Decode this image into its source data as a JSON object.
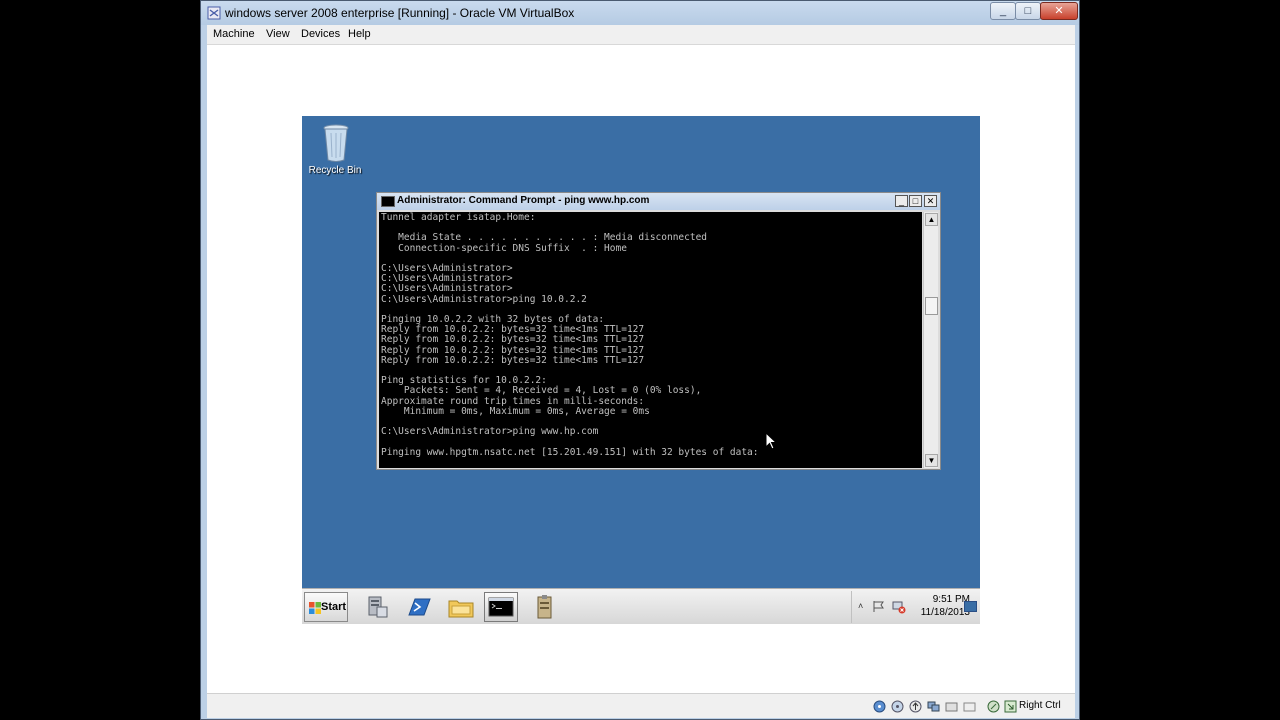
{
  "vbox": {
    "title": "windows server 2008 enterprise [Running] - Oracle VM VirtualBox",
    "controls": {
      "minimize": "_",
      "maximize": "□",
      "close": "✕"
    },
    "menu": [
      "Machine",
      "View",
      "Devices",
      "Help"
    ],
    "host_key_label": "Right Ctrl"
  },
  "desktop": {
    "background_color": "#3a6ea5",
    "recycle_bin_label": "Recycle Bin"
  },
  "cmd": {
    "title": "Administrator: Command Prompt - ping  www.hp.com",
    "lines": [
      "Tunnel adapter isatap.Home:",
      "",
      "   Media State . . . . . . . . . . . : Media disconnected",
      "   Connection-specific DNS Suffix  . : Home",
      "",
      "C:\\Users\\Administrator>",
      "C:\\Users\\Administrator>",
      "C:\\Users\\Administrator>",
      "C:\\Users\\Administrator>ping 10.0.2.2",
      "",
      "Pinging 10.0.2.2 with 32 bytes of data:",
      "Reply from 10.0.2.2: bytes=32 time<1ms TTL=127",
      "Reply from 10.0.2.2: bytes=32 time<1ms TTL=127",
      "Reply from 10.0.2.2: bytes=32 time<1ms TTL=127",
      "Reply from 10.0.2.2: bytes=32 time<1ms TTL=127",
      "",
      "Ping statistics for 10.0.2.2:",
      "    Packets: Sent = 4, Received = 4, Lost = 0 (0% loss),",
      "Approximate round trip times in milli-seconds:",
      "    Minimum = 0ms, Maximum = 0ms, Average = 0ms",
      "",
      "C:\\Users\\Administrator>ping www.hp.com",
      "",
      "Pinging www.hpgtm.nsatc.net [15.201.49.151] with 32 bytes of data:"
    ],
    "scroll_up": "▲",
    "scroll_down": "▼"
  },
  "taskbar": {
    "start_label": "Start",
    "pinned_icons": [
      "server-manager-icon",
      "powershell-icon",
      "explorer-icon",
      "command-prompt-icon",
      "tools-icon"
    ],
    "tray_expand": "˄",
    "clock_time": "9:51 PM",
    "clock_date": "11/18/2013"
  }
}
